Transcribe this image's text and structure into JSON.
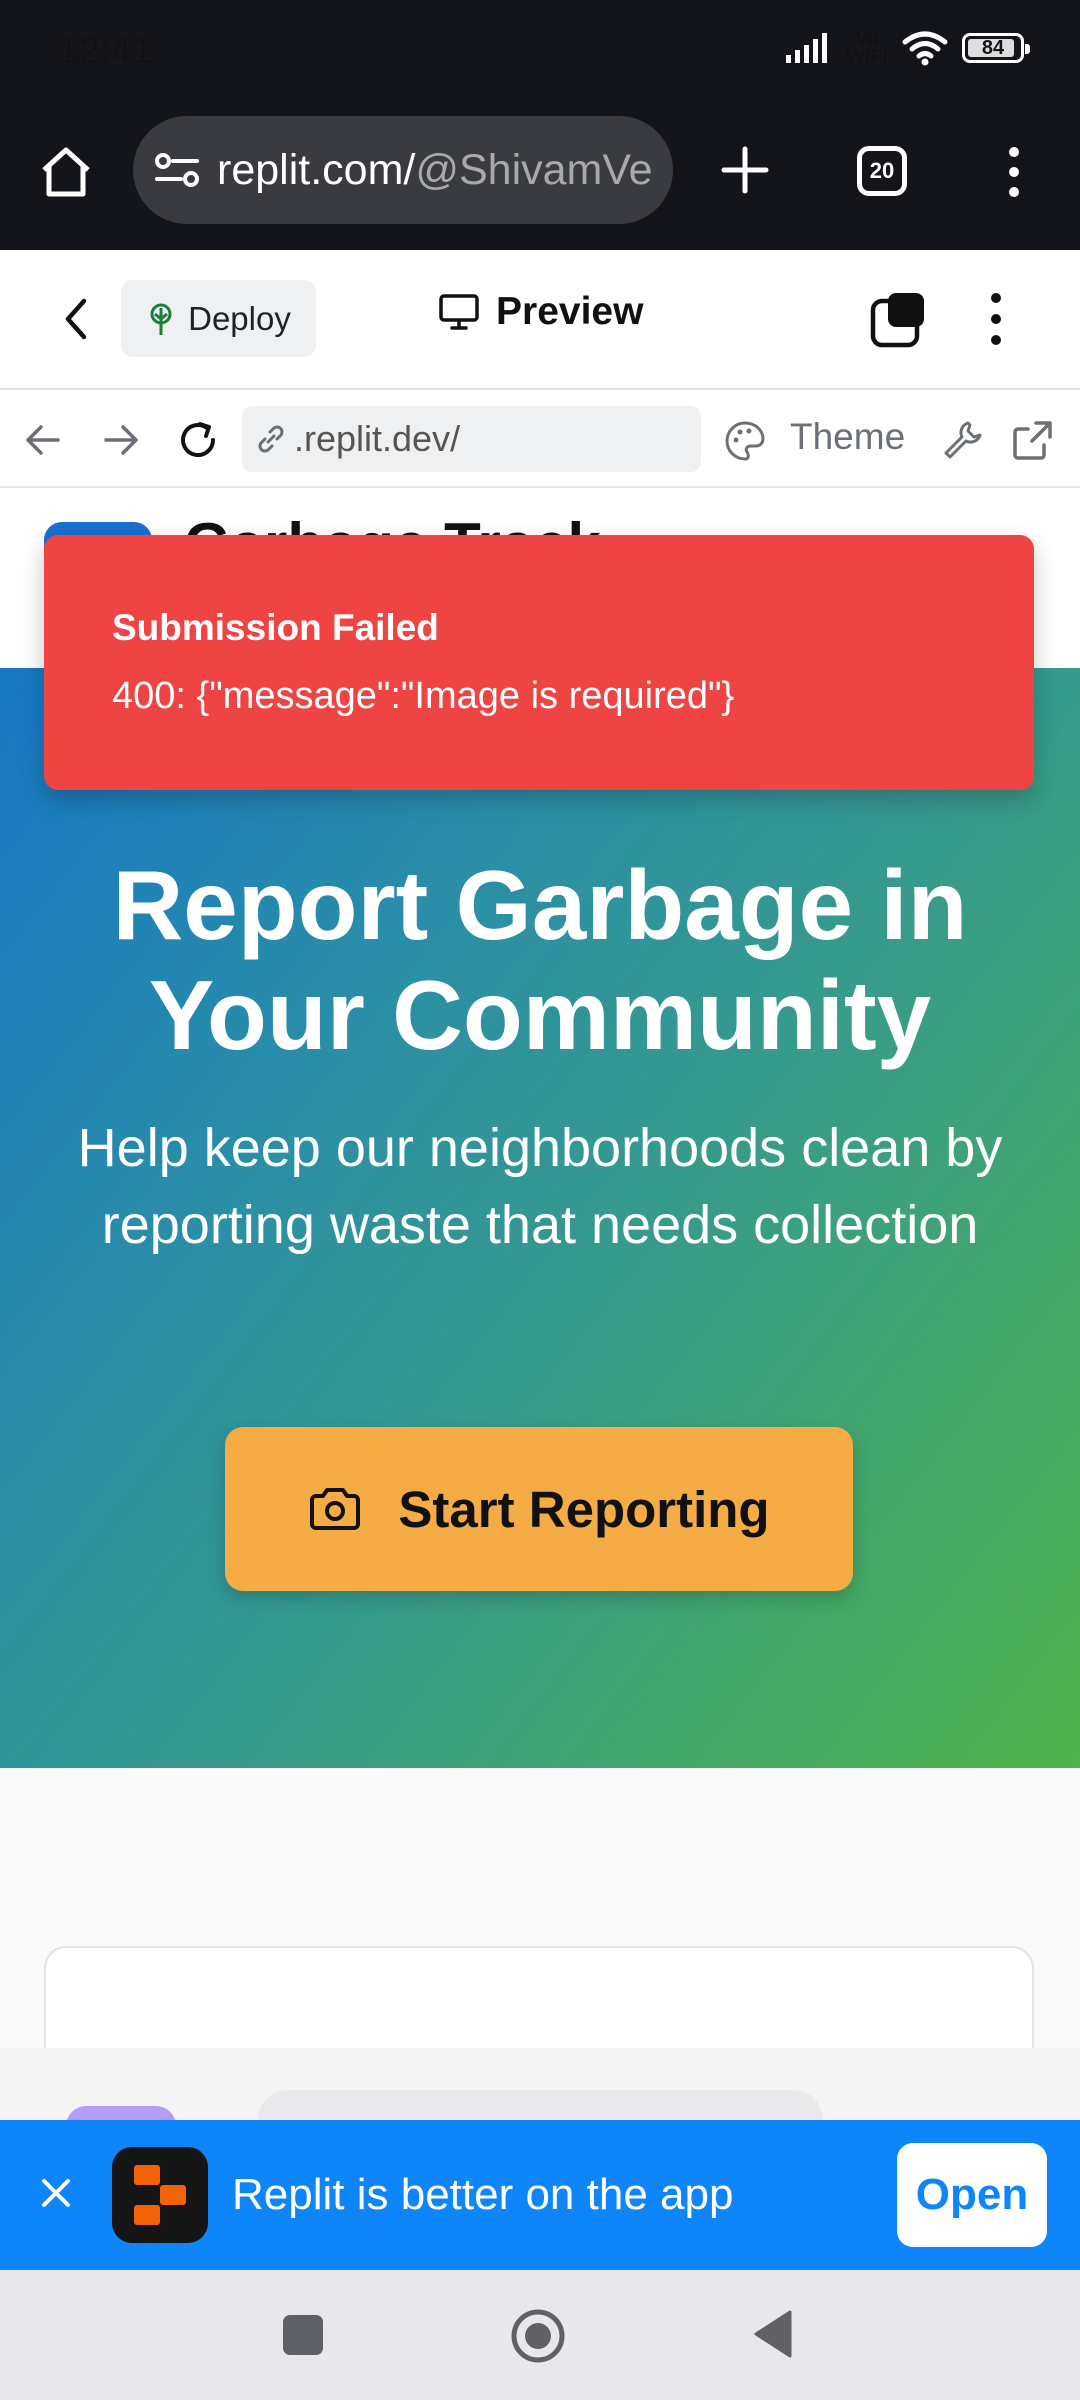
{
  "status_bar": {
    "time": "12:41",
    "network_label_top": "Vo",
    "network_label_bottom": "WiFi",
    "battery": "84"
  },
  "browser": {
    "url_host": "replit.com/",
    "url_path": "@ShivamVe",
    "tab_count": "20"
  },
  "replit_header": {
    "deploy_label": "Deploy",
    "preview_label": "Preview"
  },
  "address_row": {
    "address": ".replit.dev/",
    "theme_label": "Theme"
  },
  "app": {
    "title": "Garbage Track",
    "hero_title": "Report Garbage in Your Community",
    "hero_subtitle": "Help keep our neighborhoods clean by reporting waste that needs collection",
    "cta_label": "Start Reporting"
  },
  "toast": {
    "title": "Submission Failed",
    "description": "400: {\"message\":\"Image is required\"}"
  },
  "promo_banner": {
    "text": "Replit is better on the app",
    "open_label": "Open"
  },
  "colors": {
    "toast": "#ef4444",
    "cta": "#f5ac45",
    "promo": "#0e86f9",
    "hero_start": "#1677c4",
    "hero_end": "#4fb24a"
  }
}
